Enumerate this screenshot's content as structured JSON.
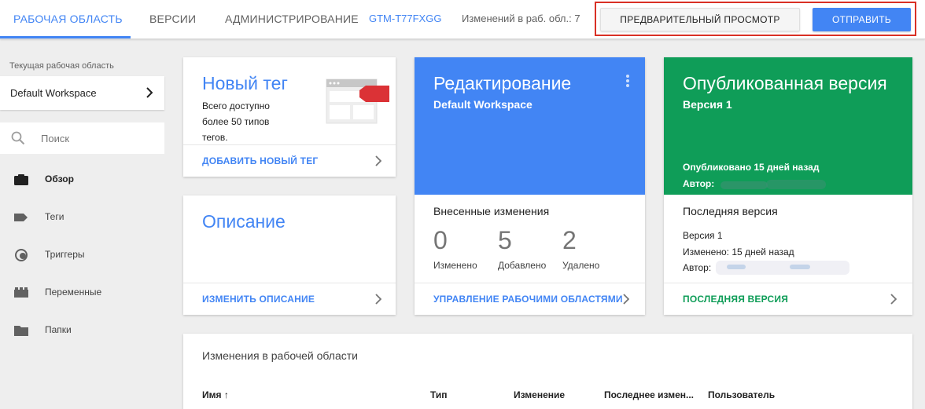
{
  "topbar": {
    "tabs": [
      {
        "label": "РАБОЧАЯ ОБЛАСТЬ",
        "active": true
      },
      {
        "label": "ВЕРСИИ",
        "active": false
      },
      {
        "label": "АДМИНИСТРИРОВАНИЕ",
        "active": false
      }
    ],
    "container_id": "GTM-T77FXGG",
    "changes_count": "Изменений в раб. обл.: 7",
    "preview_label": "ПРЕДВАРИТЕЛЬНЫЙ ПРОСМОТР",
    "submit_label": "ОТПРАВИТЬ"
  },
  "sidebar": {
    "workspace_label": "Текущая рабочая область",
    "workspace_name": "Default Workspace",
    "search_placeholder": "Поиск",
    "items": [
      {
        "label": "Обзор",
        "icon": "briefcase-icon",
        "active": true
      },
      {
        "label": "Теги",
        "icon": "tag-icon",
        "active": false
      },
      {
        "label": "Триггеры",
        "icon": "trigger-icon",
        "active": false
      },
      {
        "label": "Переменные",
        "icon": "variable-icon",
        "active": false
      },
      {
        "label": "Папки",
        "icon": "folder-icon",
        "active": false
      }
    ]
  },
  "cards": {
    "new_tag": {
      "title": "Новый тег",
      "desc_lines": [
        "Всего доступно",
        "более 50 типов",
        "тегов."
      ],
      "link": "ДОБАВИТЬ НОВЫЙ ТЕГ"
    },
    "description": {
      "title": "Описание",
      "link": "ИЗМЕНИТЬ ОПИСАНИЕ"
    },
    "editing": {
      "title": "Редактирование",
      "subtitle": "Default Workspace",
      "changes_label": "Внесенные изменения",
      "stats": [
        {
          "value": "0",
          "label": "Изменено"
        },
        {
          "value": "5",
          "label": "Добавлено"
        },
        {
          "value": "2",
          "label": "Удалено"
        }
      ],
      "link": "УПРАВЛЕНИЕ РАБОЧИМИ ОБЛАСТЯМИ"
    },
    "published": {
      "title": "Опубликованная версия",
      "subtitle": "Версия 1",
      "published_when": "Опубликовано 15 дней назад",
      "author_label": "Автор:",
      "last_label": "Последняя версия",
      "last_version": "Версия 1",
      "last_changed": "Изменено: 15 дней назад",
      "last_author_label": "Автор:",
      "link": "ПОСЛЕДНЯЯ ВЕРСИЯ"
    }
  },
  "workspace_changes": {
    "title": "Изменения в рабочей области",
    "columns": [
      "Имя ↑",
      "Тип",
      "Изменение",
      "Последнее измен...",
      "Пользователь"
    ]
  },
  "colors": {
    "accent_blue": "#4285f4",
    "publish_green": "#0f9d58",
    "highlight_red": "#d93025",
    "tag_red": "#db3236"
  }
}
